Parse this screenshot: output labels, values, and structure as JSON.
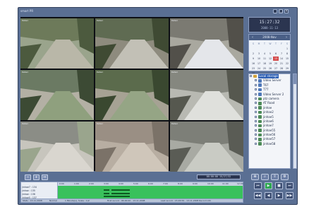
{
  "window": {
    "title": "smart PR",
    "controls": [
      {
        "name": "minimize",
        "glyph": "_"
      },
      {
        "name": "maximize",
        "glyph": "□"
      },
      {
        "name": "close",
        "glyph": "×"
      }
    ]
  },
  "cameras": [
    {
      "label": "Dahaz",
      "scene": "street-people"
    },
    {
      "label": "Dahaz",
      "scene": "storefront-street"
    },
    {
      "label": "Dahaz",
      "scene": "alley-car"
    },
    {
      "label": "Dahaz",
      "scene": "stairs-walkway"
    },
    {
      "label": "Dahaz",
      "scene": "trees-pavement"
    },
    {
      "label": "Dahaz",
      "scene": "parked-cars"
    },
    {
      "label": "Dahaz",
      "scene": "plaza-trees"
    },
    {
      "label": "Dahaz",
      "scene": "paved-lot"
    },
    {
      "label": "Dahaz",
      "scene": "narrow-street"
    }
  ],
  "clock": {
    "time": "15:27:32",
    "date": "2008-11-13"
  },
  "calendar": {
    "header": "2008-Nov",
    "weekdays": [
      "S",
      "M",
      "T",
      "W",
      "T",
      "F",
      "S"
    ],
    "days": [
      "",
      "",
      "",
      "",
      "",
      "",
      "1",
      "2",
      "3",
      "4",
      "5",
      "6",
      "7",
      "8",
      "9",
      "10",
      "11",
      "12",
      "13",
      "14",
      "15",
      "16",
      "17",
      "18",
      "19",
      "20",
      "21",
      "22",
      "23",
      "24",
      "25",
      "26",
      "27",
      "28",
      "29",
      "30",
      "",
      "",
      "",
      "",
      "",
      ""
    ],
    "selected_day": "13"
  },
  "device_tree": [
    {
      "label": "Local storage",
      "level": 0,
      "selected": true,
      "icon": "storage"
    },
    {
      "label": "Video Server",
      "level": 1,
      "icon": "server"
    },
    {
      "label": "T67",
      "level": 1,
      "icon": "server"
    },
    {
      "label": "T77",
      "level": 1,
      "icon": "server"
    },
    {
      "label": "Video Server 2",
      "level": 1,
      "icon": "server"
    },
    {
      "label": "ptz camera",
      "level": 1,
      "icon": "camera"
    },
    {
      "label": "AT Road",
      "level": 1,
      "icon": "camera"
    },
    {
      "label": "jinhae",
      "level": 1,
      "icon": "camera"
    },
    {
      "label": "jinhae2",
      "level": 1,
      "icon": "camera"
    },
    {
      "label": "jinhae5",
      "level": 1,
      "icon": "camera"
    },
    {
      "label": "jinhae6",
      "level": 1,
      "icon": "camera"
    },
    {
      "label": "jinhae7",
      "level": 1,
      "icon": "camera"
    },
    {
      "label": "jinhae55",
      "level": 1,
      "icon": "camera"
    },
    {
      "label": "jinhae56",
      "level": 1,
      "icon": "camera"
    },
    {
      "label": "jinhae57",
      "level": 1,
      "icon": "camera"
    },
    {
      "label": "jinhae58",
      "level": 1,
      "icon": "camera"
    }
  ],
  "timeline": {
    "range_text": "06:00:00 15/27/32",
    "channels": [
      "jinhae7 : 134",
      "jinhae : 135",
      "jinhae : 136",
      "jinhae5 : 137",
      "No Audio selected"
    ],
    "ticks": [
      "0:00",
      "1:00",
      "2:00",
      "3:00",
      "4:00",
      "5:00",
      "6:00",
      "7:00",
      "8:00",
      "9:00",
      "10:00",
      "11:00",
      "12:00"
    ],
    "status": {
      "state": "Stats : 13.11.2008",
      "mode": "Normal",
      "speed": "1 Minute(s), Scale : 1/2",
      "first": "First record : 06:00:00 - 13.11.2008",
      "last": "Last record : 15:26:59 - 13.11.2008 Record info"
    }
  },
  "tools": [
    {
      "name": "zoom-tool",
      "glyph": "⊕"
    },
    {
      "name": "search-tool",
      "glyph": "⌕"
    },
    {
      "name": "export-tool",
      "glyph": "⇪"
    },
    {
      "name": "settings-tool",
      "glyph": "⚙"
    }
  ],
  "playback": [
    {
      "name": "prev-frame",
      "glyph": "⏮"
    },
    {
      "name": "play",
      "glyph": "▶",
      "active": true
    },
    {
      "name": "stop",
      "glyph": "■"
    },
    {
      "name": "next-frame",
      "glyph": "⏭"
    },
    {
      "name": "rewind",
      "glyph": "◀◀"
    },
    {
      "name": "step-back",
      "glyph": "◀"
    },
    {
      "name": "step-forward",
      "glyph": "▶"
    },
    {
      "name": "fast-forward",
      "glyph": "▶▶"
    }
  ],
  "colors": {
    "frame": "#5a6f93",
    "track": "#39c15c",
    "selection": "#2d5fb4"
  }
}
